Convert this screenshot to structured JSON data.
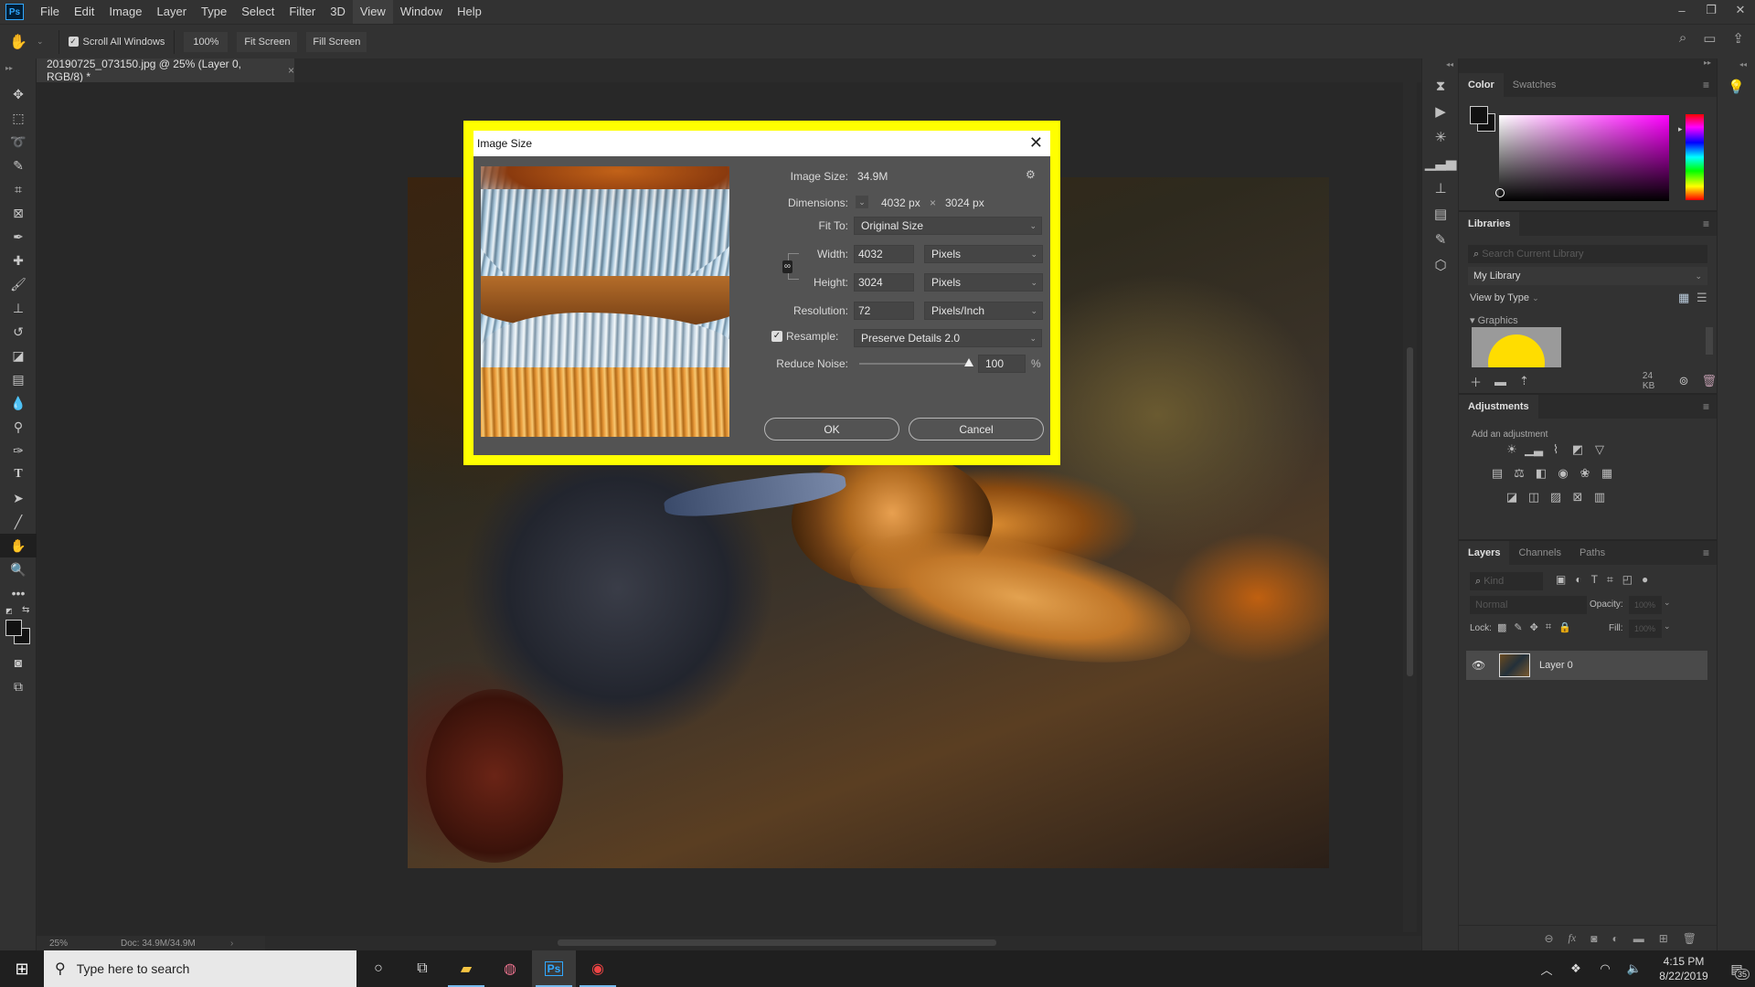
{
  "app": {
    "logo": "Ps",
    "name": "Photoshop"
  },
  "menu": [
    "File",
    "Edit",
    "Image",
    "Layer",
    "Type",
    "Select",
    "Filter",
    "3D",
    "View",
    "Window",
    "Help"
  ],
  "window_controls": {
    "minimize": "–",
    "restore": "❐",
    "close": "✕"
  },
  "options_bar": {
    "tool_icon": "hand-icon",
    "scroll_all_windows_label": "Scroll All Windows",
    "scroll_all_windows_checked": true,
    "zoom_100_label": "100%",
    "fit_screen_label": "Fit Screen",
    "fill_screen_label": "Fill Screen"
  },
  "document": {
    "tab_title": "20190725_073150.jpg @ 25% (Layer 0, RGB/8) *",
    "close_glyph": "×"
  },
  "status_bar": {
    "zoom": "25%",
    "doc_info": "Doc: 34.9M/34.9M"
  },
  "dialog": {
    "title": "Image Size",
    "close_glyph": "✕",
    "image_size_label": "Image Size:",
    "image_size_value": "34.9M",
    "dimensions_label": "Dimensions:",
    "dimensions_width": "4032 px",
    "dimensions_times": "×",
    "dimensions_height": "3024 px",
    "fit_to_label": "Fit To:",
    "fit_to_value": "Original Size",
    "width_label": "Width:",
    "width_value": "4032",
    "width_unit": "Pixels",
    "height_label": "Height:",
    "height_value": "3024",
    "height_unit": "Pixels",
    "resolution_label": "Resolution:",
    "resolution_value": "72",
    "resolution_unit": "Pixels/Inch",
    "resample_label": "Resample:",
    "resample_checked": true,
    "resample_value": "Preserve Details 2.0",
    "reduce_noise_label": "Reduce Noise:",
    "reduce_noise_value": "100",
    "reduce_noise_percent": 100,
    "percent_sign": "%",
    "ok_label": "OK",
    "cancel_label": "Cancel",
    "highlight_color": "#ffff00"
  },
  "panels": {
    "color": {
      "tabs": [
        "Color",
        "Swatches"
      ],
      "active_tab": "Color",
      "hue_color": "#ff00ff"
    },
    "libraries": {
      "tab": "Libraries",
      "search_placeholder": "Search Current Library",
      "library_name": "My Library",
      "view_by": "View by Type",
      "section": "Graphics",
      "size": "24 KB"
    },
    "adjustments": {
      "tab": "Adjustments",
      "hint": "Add an adjustment"
    },
    "layers": {
      "tabs": [
        "Layers",
        "Channels",
        "Paths"
      ],
      "active_tab": "Layers",
      "filter_placeholder": "Kind",
      "blend_mode": "Normal",
      "opacity_label": "Opacity:",
      "opacity_value": "100%",
      "lock_label": "Lock:",
      "fill_label": "Fill:",
      "fill_value": "100%",
      "layers": [
        {
          "name": "Layer 0",
          "visible": true
        }
      ]
    }
  },
  "taskbar": {
    "search_placeholder": "Type here to search",
    "time": "4:15 PM",
    "date": "8/22/2019",
    "notifications": "35"
  }
}
